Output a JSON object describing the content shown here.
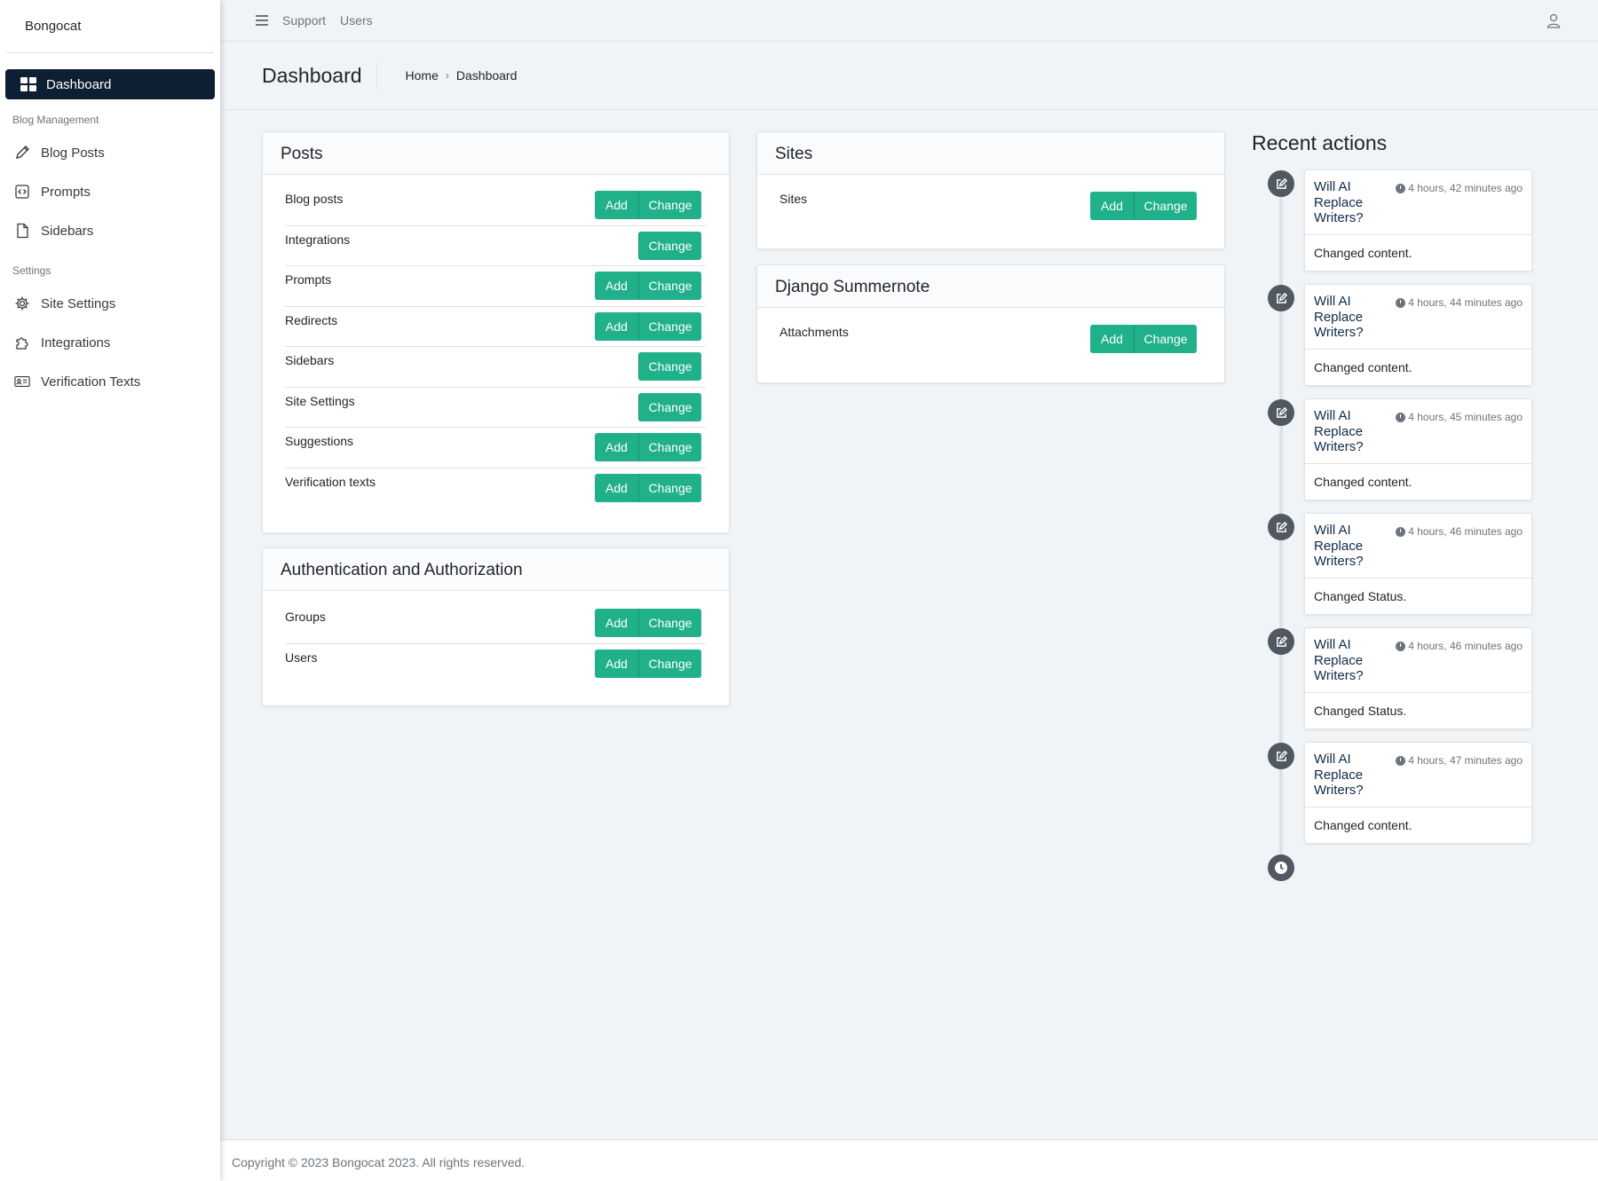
{
  "brand": "Bongocat",
  "sidebar": {
    "active": "Dashboard",
    "sections": [
      {
        "header": "Blog Management",
        "items": [
          {
            "label": "Blog Posts",
            "icon": "pencil-icon"
          },
          {
            "label": "Prompts",
            "icon": "code-icon"
          },
          {
            "label": "Sidebars",
            "icon": "file-icon"
          }
        ]
      },
      {
        "header": "Settings",
        "items": [
          {
            "label": "Site Settings",
            "icon": "gear-icon"
          },
          {
            "label": "Integrations",
            "icon": "puzzle-icon"
          },
          {
            "label": "Verification Texts",
            "icon": "id-card-icon"
          }
        ]
      }
    ]
  },
  "topbar": {
    "links": [
      "Support",
      "Users"
    ]
  },
  "header": {
    "title": "Dashboard",
    "breadcrumb": [
      "Home",
      "Dashboard"
    ]
  },
  "buttons": {
    "add": "Add",
    "change": "Change"
  },
  "cards": {
    "posts": {
      "title": "Posts",
      "rows": [
        "Blog posts",
        "Integrations",
        "Prompts",
        "Redirects",
        "Sidebars",
        "Site Settings",
        "Suggestions",
        "Verification texts"
      ]
    },
    "auth": {
      "title": "Authentication and Authorization",
      "rows": [
        "Groups",
        "Users"
      ]
    },
    "sites": {
      "title": "Sites",
      "rows": [
        "Sites"
      ]
    },
    "summernote": {
      "title": "Django Summernote",
      "rows": [
        "Attachments"
      ]
    }
  },
  "recent": {
    "title": "Recent actions",
    "items": [
      {
        "link": "Will AI Replace Writers?",
        "time": "4 hours, 42 minutes ago",
        "desc": "Changed content."
      },
      {
        "link": "Will AI Replace Writers?",
        "time": "4 hours, 44 minutes ago",
        "desc": "Changed content."
      },
      {
        "link": "Will AI Replace Writers?",
        "time": "4 hours, 45 minutes ago",
        "desc": "Changed content."
      },
      {
        "link": "Will AI Replace Writers?",
        "time": "4 hours, 46 minutes ago",
        "desc": "Changed Status."
      },
      {
        "link": "Will AI Replace Writers?",
        "time": "4 hours, 46 minutes ago",
        "desc": "Changed Status."
      },
      {
        "link": "Will AI Replace Writers?",
        "time": "4 hours, 47 minutes ago",
        "desc": "Changed content."
      }
    ]
  },
  "footer": "Copyright © 2023 Bongocat 2023. All rights reserved.",
  "colors": {
    "accent": "#20b08a",
    "sidebar_active": "#0e1f33"
  }
}
